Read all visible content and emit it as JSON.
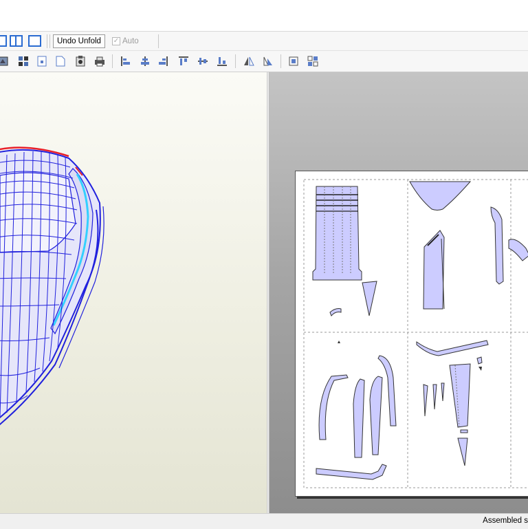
{
  "toolbar": {
    "undo_unfold_label": "Undo Unfold",
    "auto_label": "Auto",
    "auto_checked": true
  },
  "status": {
    "text": "Assembled s"
  },
  "colors": {
    "mesh_edge": "#2020dd",
    "mesh_fill": "#e6e6fa",
    "cut_edge": "#e8202a",
    "highlight": "#33d0ff",
    "part_fill": "#ccccff"
  }
}
